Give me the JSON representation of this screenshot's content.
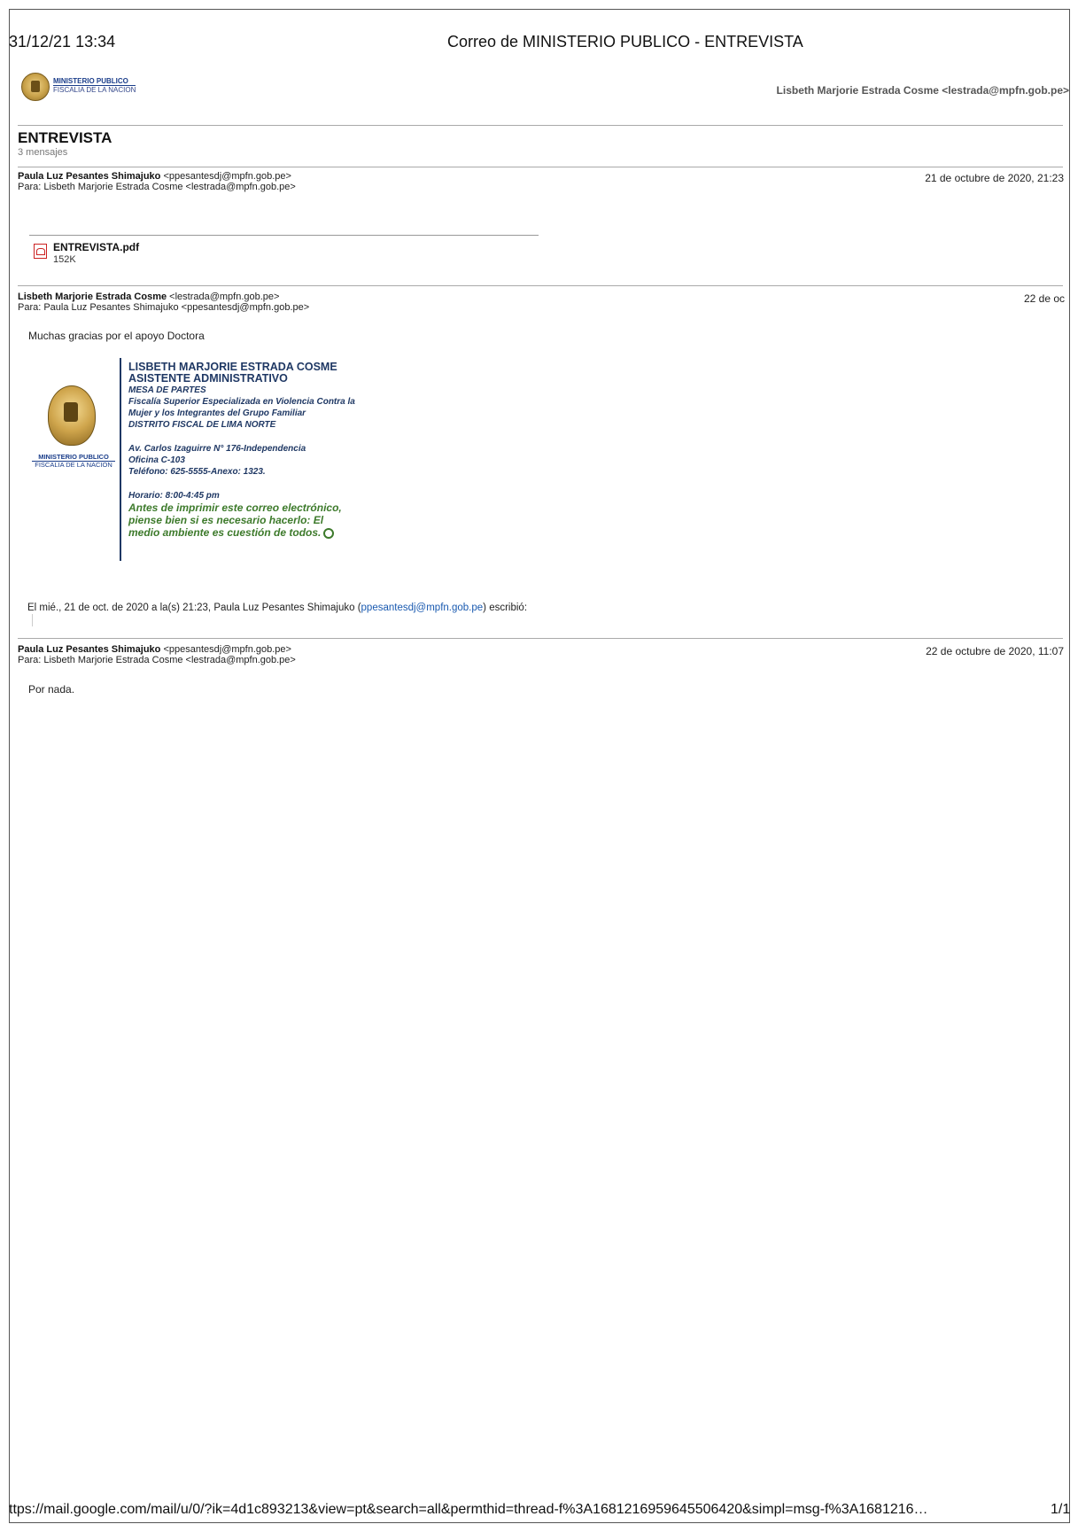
{
  "print_header": {
    "date": "31/12/21 13:34",
    "title": "Correo de MINISTERIO PUBLICO - ENTREVISTA"
  },
  "logo": {
    "line1": "MINISTERIO PUBLICO",
    "line2": "FISCALIA DE LA NACION"
  },
  "account": "Lisbeth Marjorie Estrada Cosme <lestrada@mpfn.gob.pe>",
  "thread": {
    "subject": "ENTREVISTA",
    "count": "3 mensajes"
  },
  "messages": [
    {
      "from_name": "Paula Luz Pesantes Shimajuko",
      "from_email": " <ppesantesdj@mpfn.gob.pe>",
      "to": "Para: Lisbeth Marjorie Estrada Cosme <lestrada@mpfn.gob.pe>",
      "date": "21 de octubre de 2020, 21:23",
      "attachment": {
        "name": "ENTREVISTA.pdf",
        "size": "152K"
      }
    },
    {
      "from_name": "Lisbeth Marjorie Estrada Cosme",
      "from_email": " <lestrada@mpfn.gob.pe>",
      "to": "Para: Paula Luz Pesantes Shimajuko <ppesantesdj@mpfn.gob.pe>",
      "date": "22 de oc",
      "body": "Muchas gracias por el apoyo Doctora",
      "signature": {
        "name": "LISBETH MARJORIE ESTRADA COSME",
        "role": "ASISTENTE ADMINISTRATIVO",
        "area": "MESA DE PARTES",
        "office1": "Fiscalía Superior Especializada en Violencia Contra la",
        "office2": "Mujer y los Integrantes del Grupo Familiar",
        "district": "DISTRITO FISCAL DE LIMA NORTE",
        "address": "Av. Carlos Izaguirre N° 176-Independencia",
        "room": "Oficina C-103",
        "phone": "Teléfono: 625-5555-Anexo: 1323.",
        "hours": "Horario: 8:00-4:45 pm",
        "eco1": "Antes de imprimir este correo electrónico,",
        "eco2": "piense bien si es necesario hacerlo:  El",
        "eco3": "medio ambiente es cuestión de todos."
      },
      "quote_prefix": "El mié., 21 de oct. de 2020 a la(s) 21:23, Paula Luz Pesantes Shimajuko (",
      "quote_link": "ppesantesdj@mpfn.gob.pe",
      "quote_suffix": ") escribió:"
    },
    {
      "from_name": "Paula Luz Pesantes Shimajuko",
      "from_email": " <ppesantesdj@mpfn.gob.pe>",
      "to": "Para: Lisbeth Marjorie Estrada Cosme <lestrada@mpfn.gob.pe>",
      "date": "22 de octubre de 2020, 11:07",
      "body": "Por nada."
    }
  ],
  "footer": {
    "url": "ttps://mail.google.com/mail/u/0/?ik=4d1c893213&view=pt&search=all&permthid=thread-f%3A1681216959645506420&simpl=msg-f%3A1681216…",
    "page": "1/1"
  }
}
